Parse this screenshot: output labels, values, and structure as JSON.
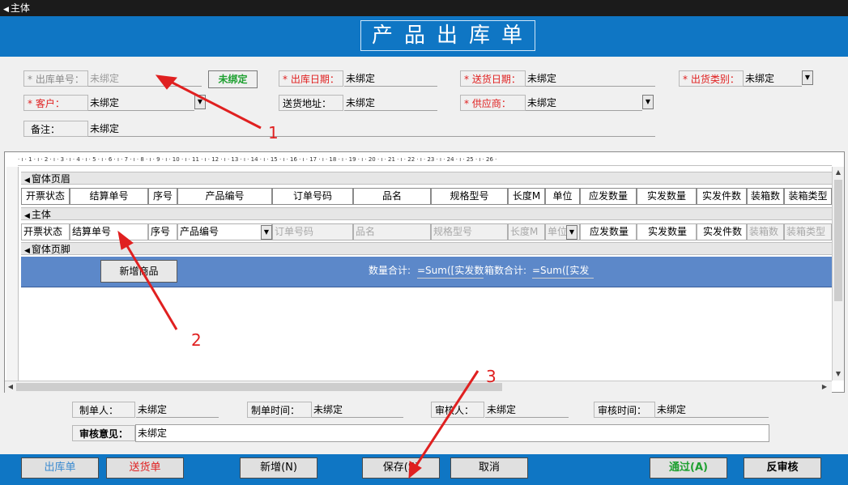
{
  "section": {
    "title": "主体"
  },
  "title": "产品出库单",
  "fields": {
    "order_no_label": "* 出库单号：",
    "order_no_value": "未绑定",
    "unbound_tag": "未绑定",
    "out_date_label": "* 出库日期：",
    "out_date_value": "未绑定",
    "delivery_date_label": "* 送货日期：",
    "delivery_date_value": "未绑定",
    "ship_type_label": "* 出货类别：",
    "ship_type_value": "未绑定",
    "customer_label": "* 客户：",
    "customer_value": "未绑定",
    "address_label": "送货地址：",
    "address_value": "未绑定",
    "supplier_label": "* 供应商：",
    "supplier_value": "未绑定",
    "remark_label": "备注：",
    "remark_value": "未绑定"
  },
  "subform": {
    "ruler": "· ı · 1 · ı · 2 · ı · 3 · ı · 4 · ı · 5 · ı · 6 · ı · 7 · ı · 8 · ı · 9 · ı · 10 · ı · 11 · ı · 12 · ı · 13 · ı · 14 · ı · 15 · ı · 16 · ı · 17 · ı · 18 · ı · 19 · ı · 20 · ı · 21 · ı · 22 · ı · 23 · ı · 24 · ı · 25 · ı · 26 ·",
    "header_band": "窗体页眉",
    "body_band": "主体",
    "footer_band": "窗体页脚",
    "columns": [
      "开票状态",
      "结算单号",
      "序号",
      "产品编号",
      "订单号码",
      "品名",
      "规格型号",
      "长度M",
      "单位",
      "应发数量",
      "实发数量",
      "实发件数",
      "装箱数",
      "装箱类型"
    ],
    "row": [
      "开票状态",
      "结算单号",
      "序号",
      "产品编号",
      "订单号码",
      "品名",
      "规格型号",
      "长度M",
      "单位",
      "应发数量",
      "实发数量",
      "实发件数",
      "装箱数",
      "装箱类型"
    ],
    "add_button": "新增商品",
    "qty_sum_label": "数量合计:",
    "qty_sum_value": "=Sum([实发数",
    "box_sum_label": "箱数合计:",
    "box_sum_value": "=Sum([实发"
  },
  "audit": {
    "maker_label": "制单人：",
    "maker_value": "未绑定",
    "make_time_label": "制单时间：",
    "make_time_value": "未绑定",
    "auditor_label": "审核人：",
    "auditor_value": "未绑定",
    "audit_time_label": "审核时间：",
    "audit_time_value": "未绑定",
    "opinion_label": "审核意见：",
    "opinion_value": "未绑定"
  },
  "buttons": {
    "outbound": "出库单",
    "delivery": "送货单",
    "add": "新增(N)",
    "save": "保存(S)",
    "cancel": "取消",
    "approve": "通过(A)",
    "unapprove": "反审核"
  },
  "annotations": [
    "1",
    "2",
    "3"
  ],
  "colors": {
    "accent_blue": "#0f76c4",
    "footer_blue": "#5c88c9",
    "required_red": "#e02020",
    "annotation_red": "#e02020",
    "approve_green": "#1ea030"
  }
}
